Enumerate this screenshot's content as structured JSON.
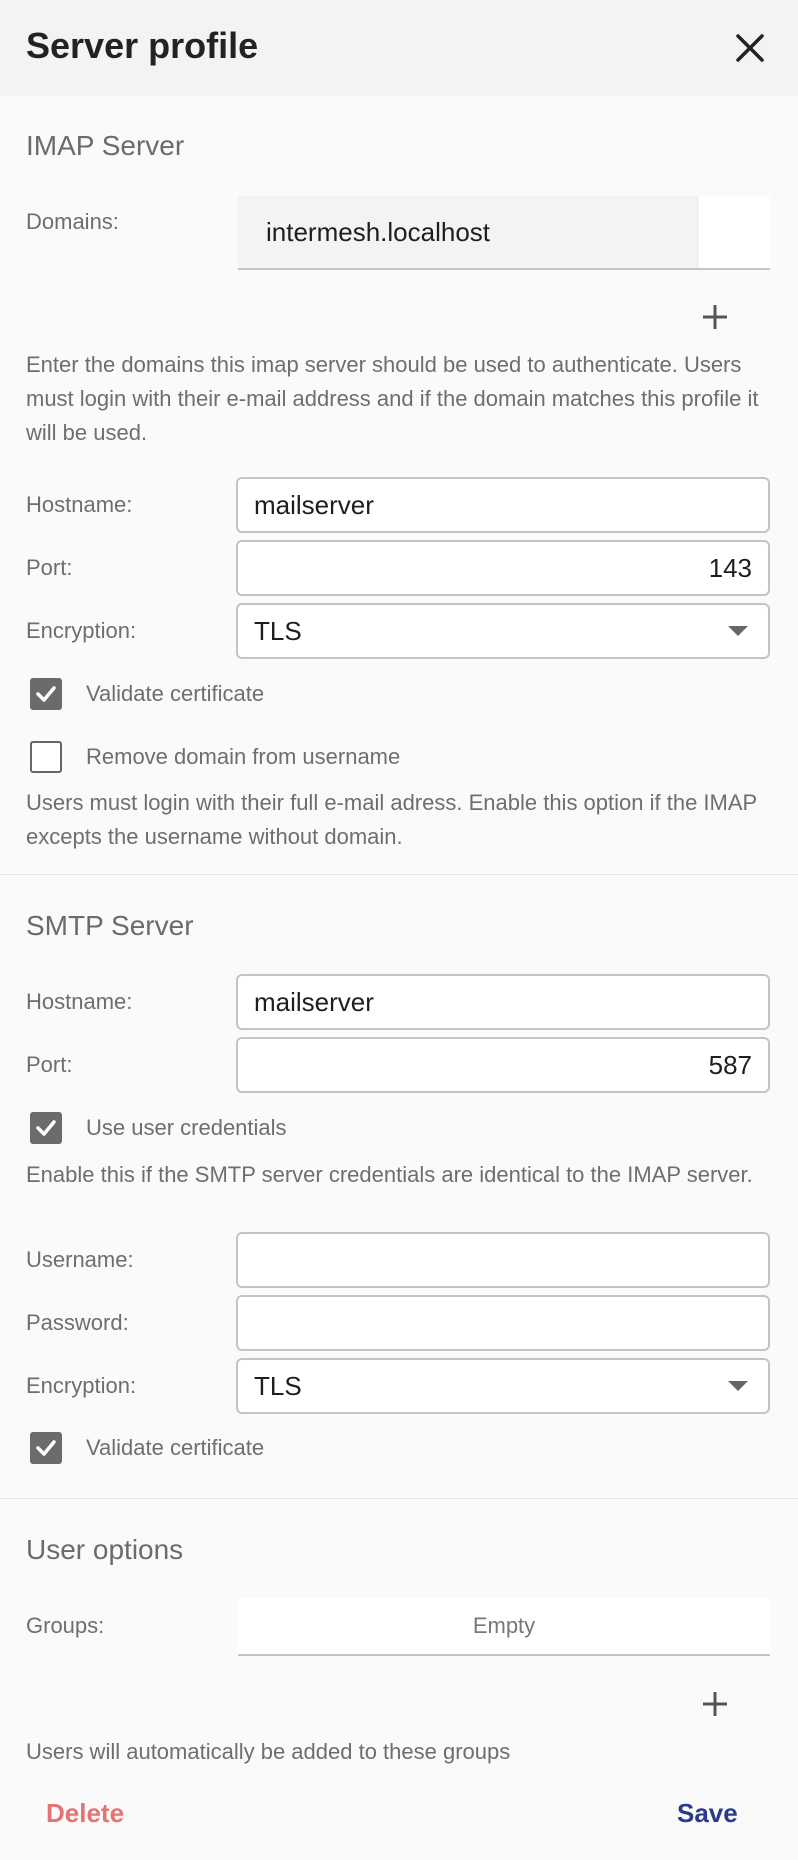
{
  "dialog": {
    "title": "Server profile",
    "close_icon": "close-icon"
  },
  "imap": {
    "section_title": "IMAP Server",
    "domains_label": "Domains:",
    "domains": [
      "intermesh.localhost"
    ],
    "domains_help": "Enter the domains this imap server should be used to authenticate. Users must login with their e-mail address and if the domain matches this profile it will be used.",
    "hostname_label": "Hostname:",
    "hostname": "mailserver",
    "port_label": "Port:",
    "port": "143",
    "encryption_label": "Encryption:",
    "encryption": "TLS",
    "validate_cert_label": "Validate certificate",
    "validate_cert_checked": true,
    "remove_domain_label": "Remove domain from username",
    "remove_domain_checked": false,
    "remove_domain_help": "Users must login with their full e-mail adress. Enable this option if the IMAP excepts the username without domain."
  },
  "smtp": {
    "section_title": "SMTP Server",
    "hostname_label": "Hostname:",
    "hostname": "mailserver",
    "port_label": "Port:",
    "port": "587",
    "use_user_credentials_label": "Use user credentials",
    "use_user_credentials_checked": true,
    "credentials_help": "Enable this if the SMTP server credentials are identical to the IMAP server.",
    "username_label": "Username:",
    "username": "",
    "password_label": "Password:",
    "password": "",
    "encryption_label": "Encryption:",
    "encryption": "TLS",
    "validate_cert_label": "Validate certificate",
    "validate_cert_checked": true
  },
  "user_options": {
    "section_title": "User options",
    "groups_label": "Groups:",
    "groups_empty_text": "Empty",
    "groups_help": "Users will automatically be added to these groups"
  },
  "footer": {
    "delete_label": "Delete",
    "save_label": "Save"
  },
  "colors": {
    "delete": "#e57373",
    "save": "#2b3a8f",
    "checkbox_checked": "#6b6b6b"
  }
}
